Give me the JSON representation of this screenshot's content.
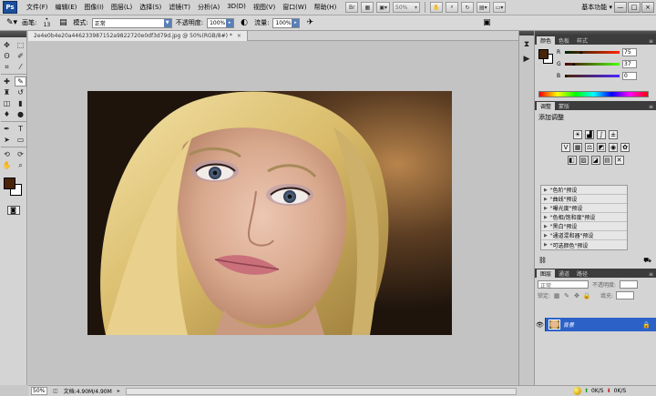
{
  "app": {
    "logo": "Ps",
    "menu": [
      "文件(F)",
      "编辑(E)",
      "图像(I)",
      "图层(L)",
      "选择(S)",
      "滤镜(T)",
      "分析(A)",
      "3D(D)",
      "视图(V)",
      "窗口(W)",
      "帮助(H)"
    ],
    "zoom_value": "50%",
    "workspace_label": "基本功能 ▾",
    "window_buttons": [
      "—",
      "□",
      "×"
    ]
  },
  "options": {
    "brush_label": "画笔:",
    "brush_size": "13",
    "mode_label": "模式:",
    "mode_value": "正常",
    "opacity_label": "不透明度:",
    "opacity_value": "100%",
    "flow_label": "流量:",
    "flow_value": "100%"
  },
  "document": {
    "tab_title": "2e4e0b4e20a446233987152a9822720e0df3d79d.jpg @ 50%(RGB/8#) *",
    "tab_close": "×",
    "status_zoom": "50%",
    "status_doc": "文档:4.90M/4.90M"
  },
  "color_panel": {
    "tabs": [
      "颜色",
      "色板",
      "样式"
    ],
    "sliders": [
      {
        "label": "R",
        "value": "75",
        "fraction": 0.29
      },
      {
        "label": "G",
        "value": "37",
        "fraction": 0.15
      },
      {
        "label": "B",
        "value": "0",
        "fraction": 0.0
      }
    ],
    "foreground": "#4a2408",
    "background": "#ffffff"
  },
  "adjust_panel": {
    "tabs": [
      "调整",
      "蒙版"
    ],
    "title": "添加调整",
    "presets": [
      "\"色阶\"预设",
      "\"曲线\"预设",
      "\"曝光度\"预设",
      "\"色相/饱和度\"预设",
      "\"黑白\"预设",
      "\"通道混和器\"预设",
      "\"可选颜色\"预设"
    ]
  },
  "layers_panel": {
    "tabs": [
      "图层",
      "通道",
      "路径"
    ],
    "blend_mode": "正常",
    "opacity_label": "不透明度:",
    "fill_label": "填充:",
    "lock_label": "锁定:",
    "layer_name": "背景"
  },
  "taskbar": {
    "up_speed": "0K/S",
    "down_speed": "0K/S"
  },
  "colors": {
    "accent_layer": "#2c62c8",
    "panel_dark": "#3c3c3c"
  }
}
